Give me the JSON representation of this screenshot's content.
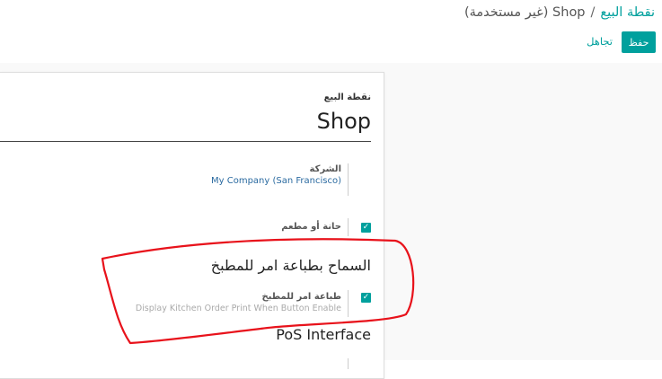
{
  "breadcrumb": {
    "parent": "نقطة البيع",
    "separator": "/",
    "current": "Shop (غير مستخدمة)"
  },
  "actions": {
    "save": "حفظ",
    "discard": "تجاهل"
  },
  "form": {
    "name_label": "نقطة البيع",
    "name_value": "Shop",
    "company_label": "الشركة",
    "company_value": "My Company (San Francisco)",
    "bar_restaurant_label": "حانة أو مطعم",
    "bar_restaurant_checked": true,
    "kitchen_section_title": "السماح بطباعة امر للمطبخ",
    "kitchen_print_label": "طباعة امر للمطبخ",
    "kitchen_print_help": "Display Kitchen Order Print When Button Enable",
    "kitchen_print_checked": true,
    "pos_interface_title": "PoS Interface"
  },
  "colors": {
    "accent": "#00A09D",
    "annotation": "#E8121B"
  }
}
